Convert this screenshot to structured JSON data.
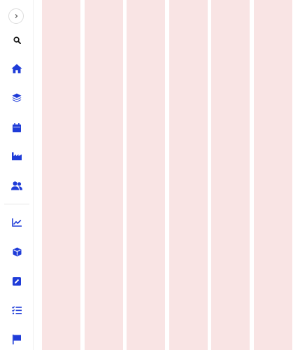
{
  "colors": {
    "accent": "#1f3cd8",
    "column_fill": "#f9e4e4",
    "divider": "#e6e6e6",
    "toggle_border": "#dcdcdc"
  },
  "sidebar": {
    "toggle_icon": "chevron-right-icon",
    "items_top": [
      {
        "icon": "search-icon"
      },
      {
        "icon": "home-icon"
      },
      {
        "icon": "layers-icon"
      },
      {
        "icon": "calendar-icon"
      },
      {
        "icon": "factory-icon"
      },
      {
        "icon": "users-icon"
      }
    ],
    "items_bottom": [
      {
        "icon": "line-chart-icon"
      },
      {
        "icon": "box-icon"
      },
      {
        "icon": "edit-icon"
      },
      {
        "icon": "checklist-icon"
      },
      {
        "icon": "flag-icon"
      }
    ]
  },
  "board": {
    "column_count": 6
  }
}
